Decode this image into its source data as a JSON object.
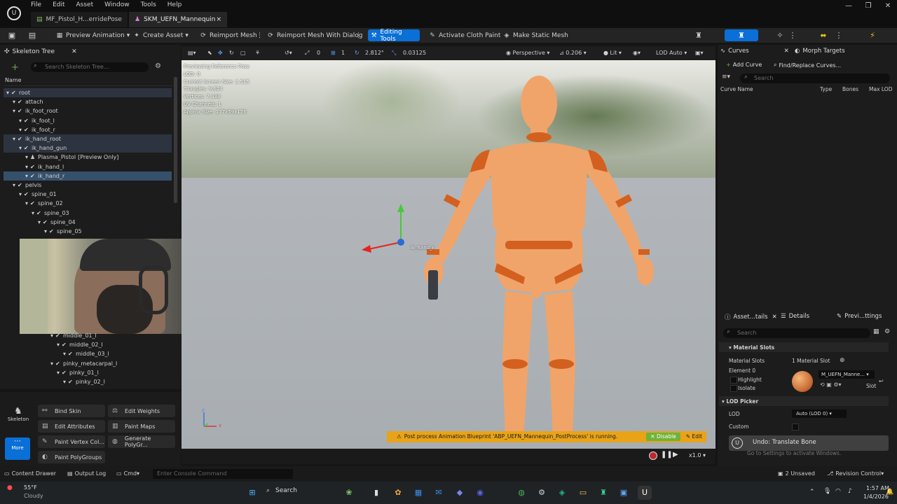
{
  "menu": [
    "File",
    "Edit",
    "Asset",
    "Window",
    "Tools",
    "Help"
  ],
  "tabs": [
    {
      "label": "MF_Pistol_H...erridePose",
      "close": "×"
    },
    {
      "label": "SKM_UEFN_Mannequin",
      "close": "×"
    }
  ],
  "window_controls": [
    "—",
    "❐",
    "✕"
  ],
  "toolbar": {
    "preview_animation": "Preview Animation",
    "create_asset": "Create Asset",
    "reimport_mesh": "Reimport Mesh",
    "reimport_mesh_dialog": "Reimport Mesh With Dialog",
    "editing_tools": "Editing Tools",
    "activate_cloth_paint": "Activate Cloth Paint",
    "make_static_mesh": "Make Static Mesh"
  },
  "skeleton_tree": {
    "tab_label": "Skeleton Tree",
    "search_placeholder": "Search Skeleton Tree...",
    "column_name": "Name",
    "bones": [
      {
        "name": "root",
        "indent": 0,
        "state": "hl"
      },
      {
        "name": "attach",
        "indent": 1,
        "state": ""
      },
      {
        "name": "ik_foot_root",
        "indent": 1,
        "state": ""
      },
      {
        "name": "ik_foot_l",
        "indent": 2,
        "state": ""
      },
      {
        "name": "ik_foot_r",
        "indent": 2,
        "state": ""
      },
      {
        "name": "ik_hand_root",
        "indent": 1,
        "state": "hl"
      },
      {
        "name": "ik_hand_gun",
        "indent": 2,
        "state": "hl"
      },
      {
        "name": "Plasma_Pistol",
        "indent": 3,
        "state": "",
        "suffix": "[Preview Only]"
      },
      {
        "name": "ik_hand_l",
        "indent": 3,
        "state": ""
      },
      {
        "name": "ik_hand_r",
        "indent": 3,
        "state": "sel"
      },
      {
        "name": "pelvis",
        "indent": 1,
        "state": ""
      },
      {
        "name": "spine_01",
        "indent": 2,
        "state": ""
      },
      {
        "name": "spine_02",
        "indent": 3,
        "state": ""
      },
      {
        "name": "spine_03",
        "indent": 4,
        "state": ""
      },
      {
        "name": "spine_04",
        "indent": 5,
        "state": ""
      },
      {
        "name": "spine_05",
        "indent": 6,
        "state": ""
      }
    ],
    "bones_lower": [
      {
        "name": "middle_01_l",
        "indent": 11
      },
      {
        "name": "middle_02_l",
        "indent": 12
      },
      {
        "name": "middle_03_l",
        "indent": 13
      },
      {
        "name": "pinky_metacarpal_l",
        "indent": 11
      },
      {
        "name": "pinky_01_l",
        "indent": 12
      },
      {
        "name": "pinky_02_l",
        "indent": 13
      }
    ]
  },
  "tools_panel": {
    "skeleton": "Skeleton",
    "more": "More",
    "buttons": [
      "Bind Skin",
      "Edit Weights",
      "Edit Attributes",
      "Paint Maps",
      "Paint Vertex Col...",
      "Generate PolyGr...",
      "Paint PolyGroups"
    ]
  },
  "viewport": {
    "tool_values": [
      "0",
      "1",
      "2.812°",
      "0.03125"
    ],
    "perspective": "Perspective",
    "fov": "0.206",
    "lit": "Lit",
    "lod": "LOD Auto",
    "stats": [
      "Previewing Reference Pose",
      "LOD: 0",
      "Current Screen Size: 1.515",
      "Triangles: 9,624",
      "Vertices: 7,438",
      "UV Channels: 1",
      "Approx Size: 177x59x176"
    ],
    "bone_label": "ik_hand_r",
    "axis_z": "z",
    "axis_x": "x",
    "notification": "Post process Animation Blueprint 'ABP_UEFN_Mannequin_PostProcess' is running.",
    "disable": "Disable",
    "edit": "Edit",
    "speed": "x1.0"
  },
  "curves_panel": {
    "tab": "Curves",
    "tab2": "Morph Targets",
    "add_curve": "Add Curve",
    "find_replace": "Find/Replace Curves...",
    "search": "Search",
    "columns": [
      "Curve Name",
      "Type",
      "Bones",
      "Max LOD"
    ]
  },
  "details_panel": {
    "tab1": "Asset...tails",
    "tab2": "Details",
    "tab3": "Previ...ttings",
    "search": "Search",
    "material_slots": "Material Slots",
    "material_slots_label": "Material Slots",
    "material_slots_value": "1 Material Slot",
    "element0": "Element 0",
    "highlight": "Highlight",
    "isolate": "Isolate",
    "material_name": "M_UEFN_Manne...",
    "slot": "Slot",
    "lod_picker": "LOD Picker",
    "lod_label": "LOD",
    "lod_value": "Auto (LOD 0)",
    "custom": "Custom",
    "undo": "Undo: Translate Bone",
    "activate_windows": "Go to Settings to activate Windows."
  },
  "statusbar": {
    "content_drawer": "Content Drawer",
    "output_log": "Output Log",
    "cmd": "Cmd",
    "console_placeholder": "Enter Console Command",
    "unsaved": "2 Unsaved",
    "revision_control": "Revision Control"
  },
  "taskbar": {
    "temp": "55°F",
    "weather": "Cloudy",
    "search": "Search",
    "time": "1:57 AM",
    "date": "1/4/2026"
  }
}
